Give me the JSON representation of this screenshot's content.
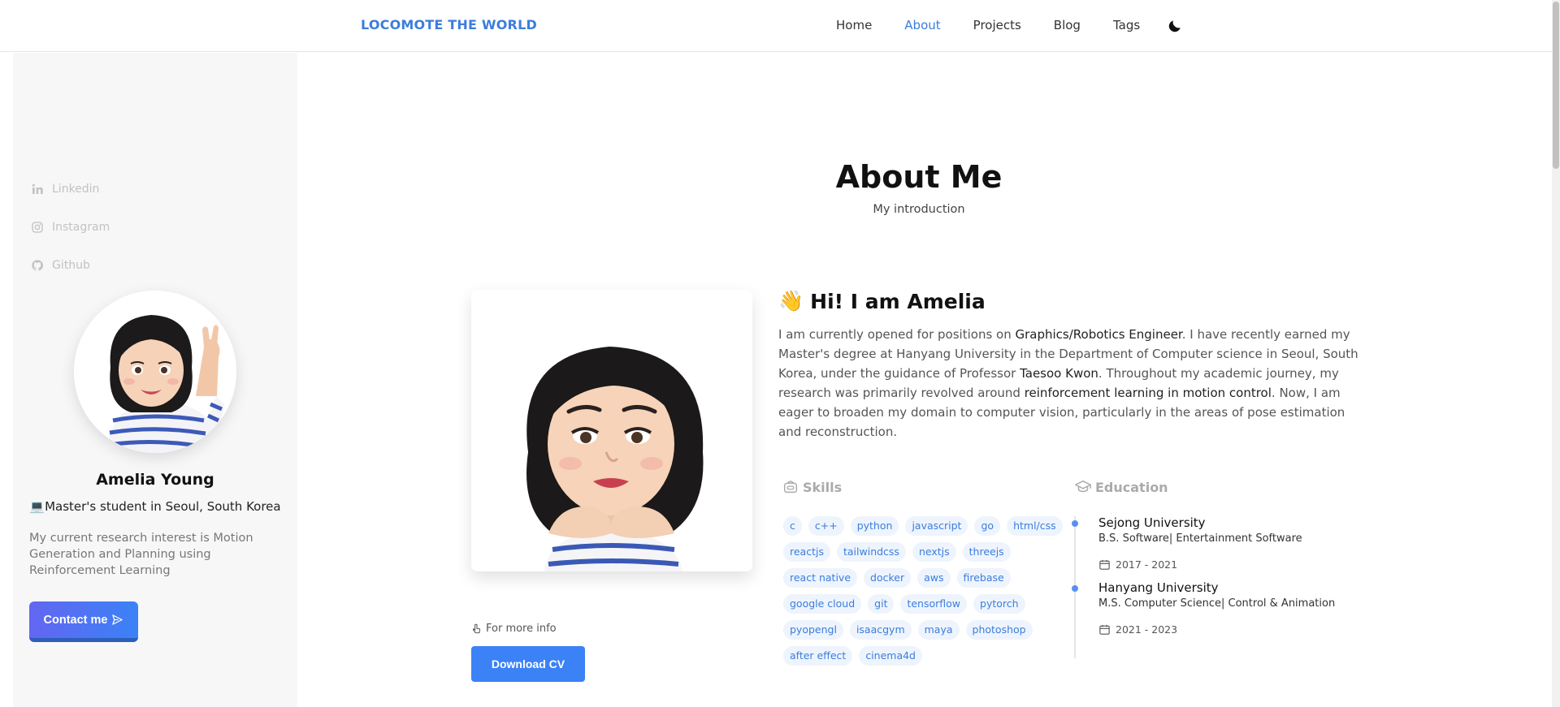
{
  "header": {
    "brand": "LOCOMOTE THE WORLD",
    "nav": [
      {
        "label": "Home"
      },
      {
        "label": "About",
        "active": true
      },
      {
        "label": "Projects"
      },
      {
        "label": "Blog"
      },
      {
        "label": "Tags"
      }
    ],
    "theme_icon": "moon-icon"
  },
  "sidebar": {
    "socials": [
      {
        "label": "Linkedin",
        "icon": "linkedin-icon"
      },
      {
        "label": "Instagram",
        "icon": "instagram-icon"
      },
      {
        "label": "Github",
        "icon": "github-icon"
      }
    ],
    "name": "Amelia Young",
    "role": "💻Master's student in Seoul, South Korea",
    "bio": "My current research interest is Motion Generation and Planning using Reinforcement Learning",
    "contact_label": "Contact me"
  },
  "main": {
    "title": "About Me",
    "subtitle": "My introduction",
    "greeting_emoji": "👋",
    "greeting": "Hi! I am Amelia",
    "intro": {
      "p1": "I am currently opened for positions on ",
      "h1": "Graphics/Robotics Engineer",
      "p2": ". I have recently earned my Master's degree at Hanyang University in the Department of Computer science in Seoul, South Korea, under the guidance of Professor ",
      "h2": "Taesoo Kwon",
      "p3": ". Throughout my academic journey, my research was primarily revolved around ",
      "h3": "reinforcement learning in motion control",
      "p4": ". Now, I am eager to broaden my domain to computer vision, particularly in the areas of pose estimation and reconstruction."
    },
    "more_info": "For more info",
    "download_label": "Download CV",
    "skills": {
      "heading": "Skills",
      "rows": [
        [
          "c",
          "c++",
          "python",
          "javascript",
          "go",
          "html/css"
        ],
        [
          "reactjs",
          "tailwindcss",
          "nextjs",
          "threejs"
        ],
        [
          "react native",
          "docker",
          "aws",
          "firebase"
        ],
        [
          "google cloud",
          "git",
          "tensorflow",
          "pytorch"
        ],
        [
          "pyopengl",
          "isaacgym",
          "maya",
          "photoshop"
        ],
        [
          "after effect",
          "cinema4d"
        ]
      ]
    },
    "education": {
      "heading": "Education",
      "items": [
        {
          "school": "Sejong University",
          "degree": "B.S. Software| Entertainment Software",
          "years": "2017 - 2021"
        },
        {
          "school": "Hanyang University",
          "degree": "M.S. Computer Science| Control & Animation",
          "years": "2021 - 2023"
        }
      ]
    }
  },
  "colors": {
    "accent": "#3b7ddd",
    "tag_bg": "#eef4fd",
    "sidebar_bg": "#f7f7f7"
  }
}
